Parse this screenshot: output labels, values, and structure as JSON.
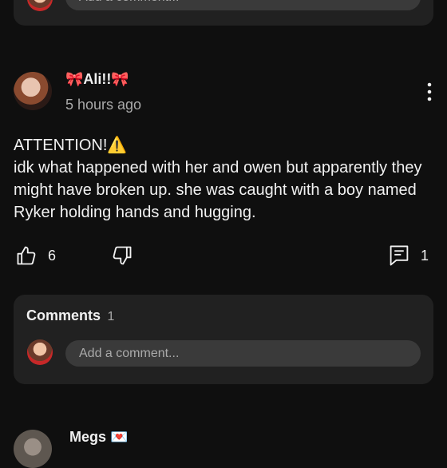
{
  "top_card": {
    "input_placeholder": "Add a comment..."
  },
  "post": {
    "author_name": "🎀Ali!!🎀",
    "timestamp": "5 hours ago",
    "body_line1": "ATTENTION!⚠️",
    "body_rest": "idk what happened with her and owen but apparently they might have broken up. she was caught with a boy named Ryker holding hands and hugging.",
    "likes": "6",
    "replies": "1",
    "icons": {
      "more": "more-vert-icon",
      "like": "thumbs-up-icon",
      "dislike": "thumbs-down-icon",
      "reply": "comment-icon"
    }
  },
  "comments_card": {
    "title": "Comments",
    "count": "1",
    "input_placeholder": "Add a comment..."
  },
  "next_post": {
    "author_name": "Megs 💌"
  }
}
